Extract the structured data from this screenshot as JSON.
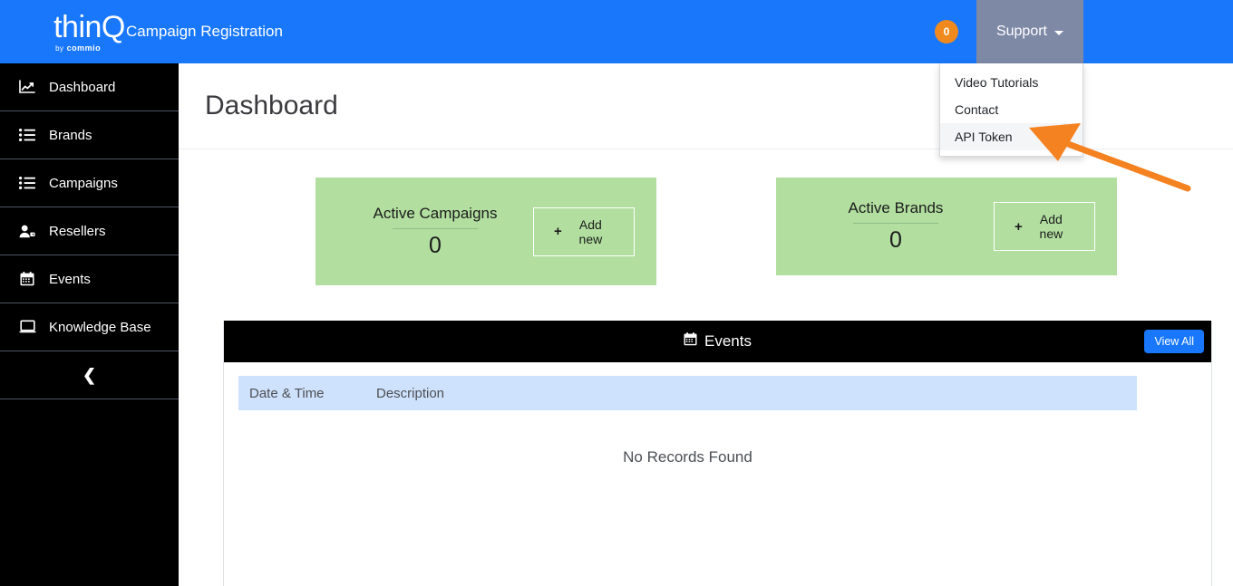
{
  "header": {
    "logo_main": "thinQ",
    "logo_by": "by",
    "logo_company": "commio",
    "app_title": "Campaign Registration",
    "badge_count": "0",
    "support_label": "Support",
    "support_caret_icon": "caret-down-icon",
    "accent_blue": "#1877fb",
    "badge_orange": "#f08a1e",
    "support_bg": "#7e89a6"
  },
  "support_menu": {
    "items": [
      {
        "label": "Video Tutorials",
        "active": false
      },
      {
        "label": "Contact",
        "active": false
      },
      {
        "label": "API Token",
        "active": true
      }
    ]
  },
  "sidebar": {
    "items": [
      {
        "label": "Dashboard",
        "icon": "chart-line-icon"
      },
      {
        "label": "Brands",
        "icon": "list-icon"
      },
      {
        "label": "Campaigns",
        "icon": "list-icon"
      },
      {
        "label": "Resellers",
        "icon": "user-tag-icon"
      },
      {
        "label": "Events",
        "icon": "calendar-icon"
      },
      {
        "label": "Knowledge Base",
        "icon": "monitor-icon"
      }
    ],
    "collapse_icon": "chevron-left-icon",
    "background": "#000000"
  },
  "main": {
    "page_title": "Dashboard",
    "cards": [
      {
        "label": "Active Campaigns",
        "value": "0",
        "button_label": "Add new",
        "button_icon": "plus-icon",
        "color": "#b2dfa0"
      },
      {
        "label": "Active Brands",
        "value": "0",
        "button_label": "Add new",
        "button_icon": "plus-icon",
        "color": "#b2dfa0"
      }
    ],
    "events_panel": {
      "title": "Events",
      "title_icon": "calendar-icon",
      "view_all_label": "View All",
      "columns": [
        "Date & Time",
        "Description"
      ],
      "rows": [],
      "empty_message": "No Records Found",
      "header_bg": "#000000",
      "table_header_bg": "#cfe2fd"
    }
  },
  "annotation": {
    "arrow_color": "#f58220",
    "points_to": "API Token"
  }
}
